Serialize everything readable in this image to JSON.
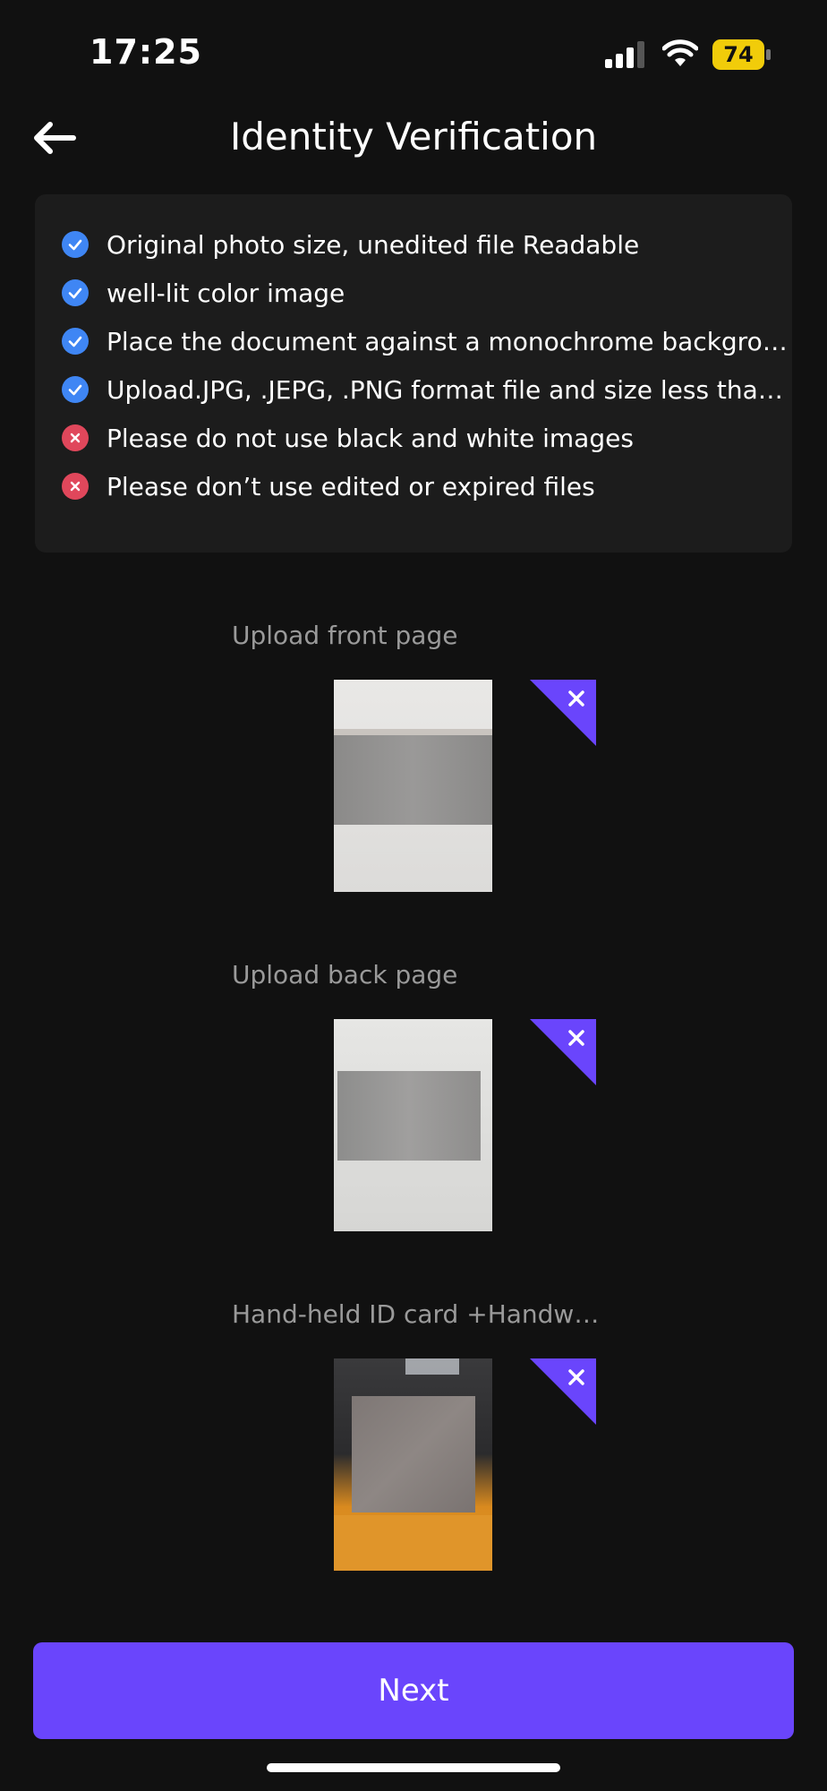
{
  "status": {
    "time": "17:25",
    "battery": "74"
  },
  "header": {
    "title": "Identity Verification"
  },
  "rules": [
    {
      "type": "ok",
      "text": "Original photo size, unedited file Readable"
    },
    {
      "type": "ok",
      "text": "well-lit color image"
    },
    {
      "type": "ok",
      "text": "Place the document against a monochrome background"
    },
    {
      "type": "ok",
      "text": "Upload.JPG, .JEPG, .PNG format file and size less than…"
    },
    {
      "type": "no",
      "text": "Please do not use black and white images"
    },
    {
      "type": "no",
      "text": "Please don’t use edited or expired files"
    }
  ],
  "uploads": [
    {
      "label": "Upload front page"
    },
    {
      "label": "Upload back page"
    },
    {
      "label": "Hand-held ID card +Handw…"
    }
  ],
  "next_label": "Next",
  "colors": {
    "accent": "#6a45fc",
    "ok": "#3f86f4",
    "error": "#e0475b",
    "battery": "#f1cc0a"
  }
}
